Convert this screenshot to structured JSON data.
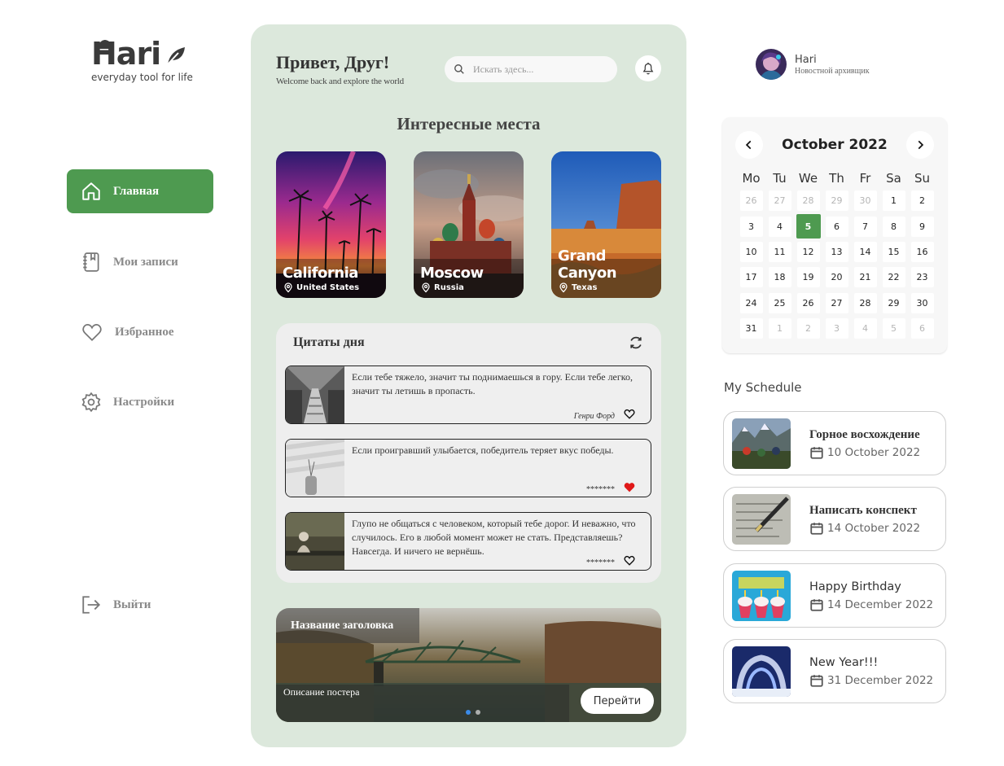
{
  "brand": {
    "name": "Hari",
    "tagline": "everyday tool for life"
  },
  "nav": {
    "items": [
      {
        "label": "Главная",
        "icon": "home-icon",
        "active": true
      },
      {
        "label": "Мои записи",
        "icon": "notebook-icon",
        "active": false
      },
      {
        "label": "Избранное",
        "icon": "heart-icon",
        "active": false
      },
      {
        "label": "Настройки",
        "icon": "gear-icon",
        "active": false
      }
    ],
    "logout": {
      "label": "Выйти",
      "icon": "logout-icon"
    }
  },
  "header": {
    "greeting": "Привет, Друг!",
    "subtitle": "Welcome back and explore the world",
    "search_placeholder": "Искать здесь..."
  },
  "places": {
    "title": "Интересные места",
    "items": [
      {
        "name": "California",
        "location": "United States"
      },
      {
        "name": "Moscow",
        "location": "Russia"
      },
      {
        "name": "Grand Canyon",
        "location": "Texas"
      }
    ]
  },
  "quotes": {
    "title": "Цитаты дня",
    "items": [
      {
        "text": "Если тебе тяжело, значит ты поднимаешься в гору. Если тебе легко, значит ты летишь в пропасть.",
        "author": "Генри Форд",
        "liked": false
      },
      {
        "text": "Если проигравший улыбается, победитель теряет вкус победы.",
        "author": "*******",
        "liked": true
      },
      {
        "text": "Глупо не общаться с человеком, который тебе дорог. И неважно, что случилось. Его в любой момент может не стать. Представляешь? Навсегда. И ничего не вернёшь.",
        "author": "*******",
        "liked": false
      }
    ]
  },
  "poster": {
    "title": "Название заголовка",
    "description": "Описание постера",
    "button_label": "Перейти",
    "slide_count": 2,
    "active_slide": 0
  },
  "profile": {
    "name": "Hari",
    "role": "Новостной архивщик"
  },
  "calendar": {
    "title": "October 2022",
    "weekdays": [
      "Mo",
      "Tu",
      "We",
      "Th",
      "Fr",
      "Sa",
      "Su"
    ],
    "days": [
      [
        "26",
        "27",
        "28",
        "29",
        "30",
        "1",
        "2"
      ],
      [
        "3",
        "4",
        "5",
        "6",
        "7",
        "8",
        "9"
      ],
      [
        "10",
        "11",
        "12",
        "13",
        "14",
        "15",
        "16"
      ],
      [
        "17",
        "18",
        "19",
        "20",
        "21",
        "22",
        "23"
      ],
      [
        "24",
        "25",
        "26",
        "27",
        "28",
        "29",
        "30"
      ],
      [
        "31",
        "1",
        "2",
        "3",
        "4",
        "5",
        "6"
      ]
    ],
    "selected_day": "5",
    "accent_color": "#4e9a50"
  },
  "schedule": {
    "title": "My Schedule",
    "items": [
      {
        "title": "Горное восхождение",
        "date": "10 October 2022"
      },
      {
        "title": "Написать конспект",
        "date": "14 October 2022"
      },
      {
        "title": "Happy Birthday",
        "date": "14 December 2022"
      },
      {
        "title": "New Year!!!",
        "date": "31 December 2022"
      }
    ]
  }
}
